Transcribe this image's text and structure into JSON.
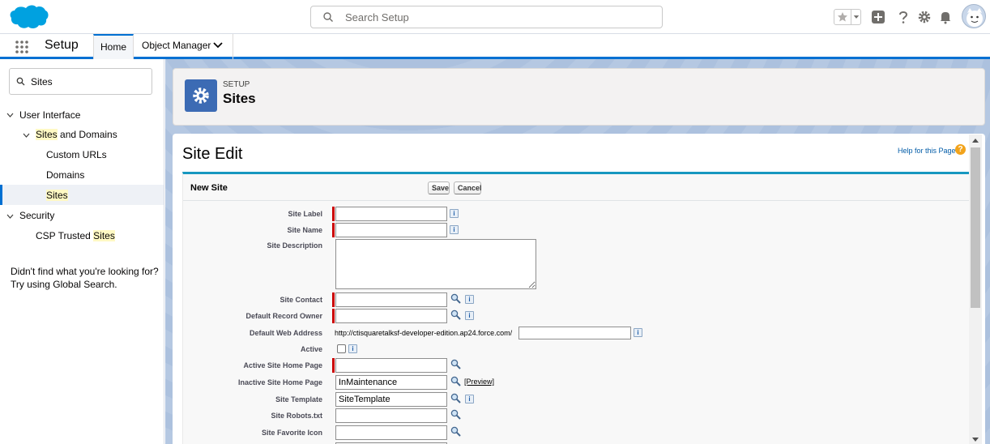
{
  "header": {
    "search_placeholder": "Search Setup"
  },
  "nav": {
    "app_name": "Setup",
    "tabs": [
      {
        "label": "Home"
      },
      {
        "label": "Object Manager"
      }
    ]
  },
  "sidebar": {
    "quick_find_value": "Sites",
    "tree": [
      {
        "label": "User Interface"
      },
      {
        "label_hl": "Sites",
        "label_rest": " and Domains"
      },
      {
        "label": "Custom URLs"
      },
      {
        "label": "Domains"
      },
      {
        "label_hl": "Sites"
      },
      {
        "label": "Security"
      },
      {
        "label_pre": "CSP Trusted ",
        "label_hl": "Sites"
      }
    ],
    "not_found_line1": "Didn't find what you're looking for?",
    "not_found_line2": "Try using Global Search."
  },
  "page_header": {
    "eyebrow": "SETUP",
    "title": "Sites"
  },
  "content": {
    "title": "Site Edit",
    "help_link": "Help for this Page",
    "help_icon": "?"
  },
  "form": {
    "section_title": "New Site",
    "save_label": "Save",
    "cancel_label": "Cancel",
    "info_glyph": "i",
    "fields": {
      "site_label": {
        "label": "Site Label",
        "value": ""
      },
      "site_name": {
        "label": "Site Name",
        "value": ""
      },
      "site_description": {
        "label": "Site Description",
        "value": ""
      },
      "site_contact": {
        "label": "Site Contact",
        "value": ""
      },
      "default_record_owner": {
        "label": "Default Record Owner",
        "value": ""
      },
      "default_web_address": {
        "label": "Default Web Address",
        "prefix": "http://ctisquaretalksf-developer-edition.ap24.force.com/",
        "value": ""
      },
      "active": {
        "label": "Active",
        "checked": false
      },
      "active_home_page": {
        "label": "Active Site Home Page",
        "value": ""
      },
      "inactive_home_page": {
        "label": "Inactive Site Home Page",
        "value": "InMaintenance",
        "preview_label": "[Preview]"
      },
      "site_template": {
        "label": "Site Template",
        "value": "SiteTemplate"
      },
      "robots": {
        "label": "Site Robots.txt",
        "value": ""
      },
      "favicon": {
        "label": "Site Favorite Icon",
        "value": ""
      }
    }
  },
  "colors": {
    "brand_blue": "#0070d2",
    "required_red": "#cc0000",
    "section_blue": "#1797c0"
  }
}
